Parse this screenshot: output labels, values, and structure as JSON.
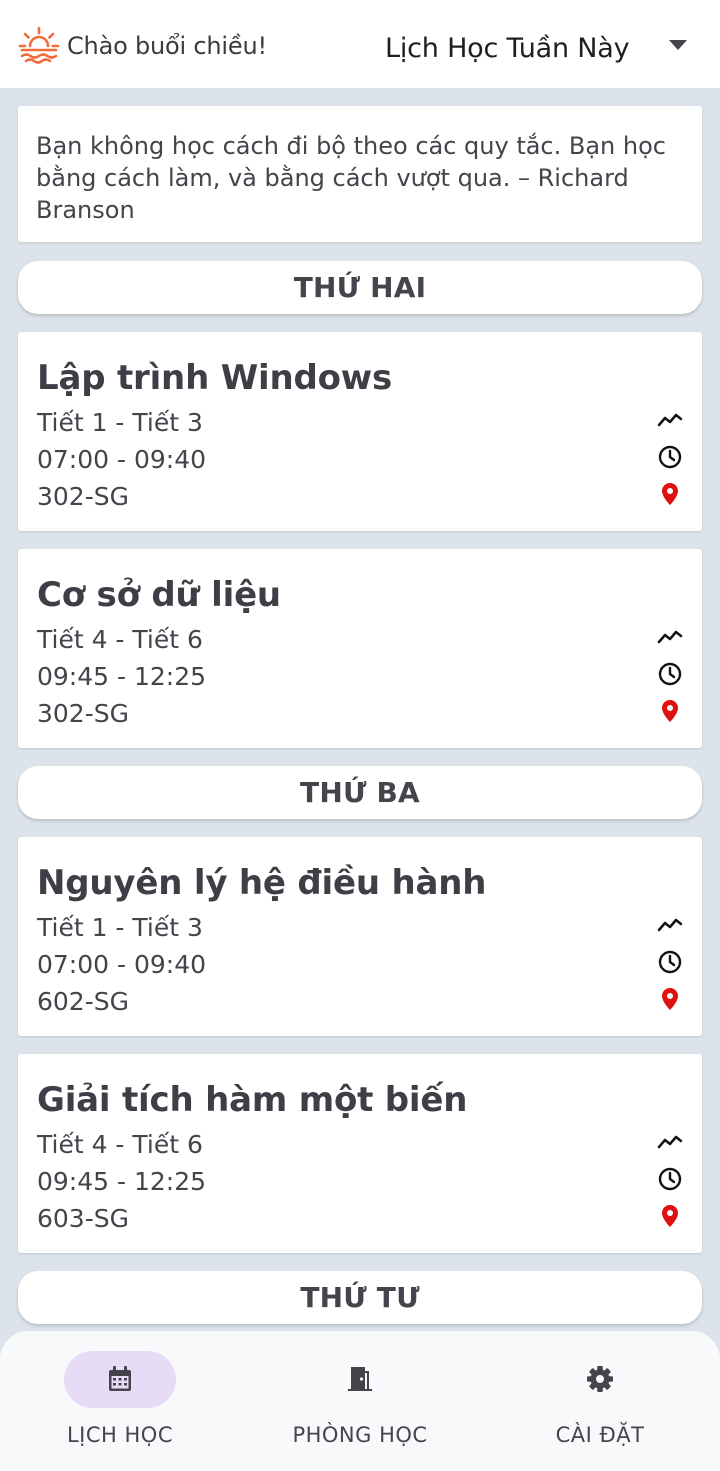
{
  "header": {
    "greeting": "Chào buổi chiều!",
    "week_selector": "Lịch Học Tuần Này"
  },
  "quote": "Bạn không học cách đi bộ theo các quy tắc. Bạn học bằng cách làm, và bằng cách vượt qua. – Richard Branson",
  "days": [
    {
      "label": "THỨ HAI"
    },
    {
      "label": "THỨ BA"
    },
    {
      "label": "THỨ TƯ"
    }
  ],
  "classes": [
    {
      "title": "Lập trình Windows",
      "periods": "Tiết 1 - Tiết 3",
      "time": "07:00 - 09:40",
      "room": "302-SG"
    },
    {
      "title": "Cơ sở dữ liệu",
      "periods": "Tiết 4 - Tiết 6",
      "time": "09:45 - 12:25",
      "room": "302-SG"
    },
    {
      "title": "Nguyên lý hệ điều hành",
      "periods": "Tiết 1 - Tiết 3",
      "time": "07:00 - 09:40",
      "room": "602-SG"
    },
    {
      "title": "Giải tích hàm một biến",
      "periods": "Tiết 4 - Tiết 6",
      "time": "09:45 - 12:25",
      "room": "603-SG"
    }
  ],
  "nav": {
    "schedule": "LỊCH HỌC",
    "rooms": "PHÒNG HỌC",
    "settings": "CÀI ĐẶT"
  },
  "colors": {
    "accent_sunset": "#f26b3a",
    "location_pin": "#e01010",
    "nav_active_bg": "#e6dcf5"
  },
  "icons": {
    "greeting": "sunset-icon",
    "periods": "trending-line-icon",
    "time": "clock-icon",
    "room": "location-pin-icon",
    "nav_schedule": "calendar-icon",
    "nav_rooms": "door-icon",
    "nav_settings": "gear-icon"
  }
}
